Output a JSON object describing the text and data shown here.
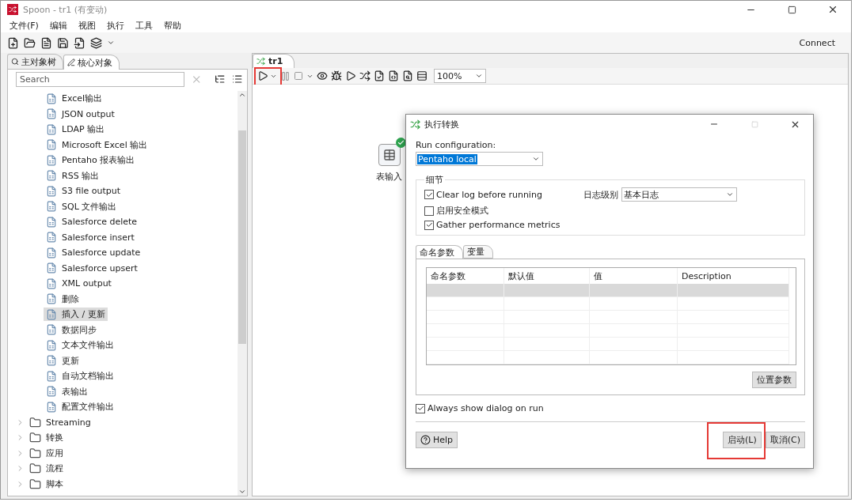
{
  "window": {
    "title": "Spoon - tr1 (有变动)"
  },
  "menu": [
    "文件(F)",
    "编辑",
    "视图",
    "执行",
    "工具",
    "帮助"
  ],
  "toolbar": {
    "connect": "Connect"
  },
  "left_panel": {
    "tabs": [
      {
        "label": "主对象树",
        "selected": false
      },
      {
        "label": "核心对象",
        "selected": true
      }
    ],
    "search": {
      "placeholder": "Search"
    },
    "steps": [
      {
        "label": "Excel输出",
        "selected": false
      },
      {
        "label": "JSON output",
        "selected": false
      },
      {
        "label": "LDAP 输出",
        "selected": false
      },
      {
        "label": "Microsoft Excel 输出",
        "selected": false
      },
      {
        "label": "Pentaho 报表输出",
        "selected": false
      },
      {
        "label": "RSS 输出",
        "selected": false
      },
      {
        "label": "S3 file output",
        "selected": false
      },
      {
        "label": "SQL 文件输出",
        "selected": false
      },
      {
        "label": "Salesforce delete",
        "selected": false
      },
      {
        "label": "Salesforce insert",
        "selected": false
      },
      {
        "label": "Salesforce update",
        "selected": false
      },
      {
        "label": "Salesforce upsert",
        "selected": false
      },
      {
        "label": "XML output",
        "selected": false
      },
      {
        "label": "删除",
        "selected": false
      },
      {
        "label": "插入 / 更新",
        "selected": true
      },
      {
        "label": "数据同步",
        "selected": false
      },
      {
        "label": "文本文件输出",
        "selected": false
      },
      {
        "label": "更新",
        "selected": false
      },
      {
        "label": "自动文档输出",
        "selected": false
      },
      {
        "label": "表输出",
        "selected": false
      },
      {
        "label": "配置文件输出",
        "selected": false
      }
    ],
    "folders": [
      {
        "label": "Streaming",
        "expanded": false
      },
      {
        "label": "转换",
        "expanded": false
      },
      {
        "label": "应用",
        "expanded": false
      },
      {
        "label": "流程",
        "expanded": false
      },
      {
        "label": "脚本",
        "expanded": false
      }
    ]
  },
  "editor": {
    "tab": {
      "label": "tr1",
      "selected": true
    },
    "run_highlighted": true,
    "zoom": "100%",
    "node": {
      "label": "表输入",
      "ok": true
    }
  },
  "dialog": {
    "title": "执行转换",
    "run_configuration": {
      "label": "Run configuration:",
      "value": "Pentaho local"
    },
    "details": {
      "title": "细节",
      "options": [
        {
          "label": "Clear log before running",
          "checked": true
        },
        {
          "label": "启用安全模式",
          "checked": false
        },
        {
          "label": "Gather performance metrics",
          "checked": true
        }
      ],
      "log_level": {
        "label": "日志级别",
        "value": "基本日志"
      }
    },
    "tabs": [
      {
        "label": "命名参数",
        "selected": true
      },
      {
        "label": "变量",
        "selected": false
      }
    ],
    "table": {
      "columns": [
        "命名参数",
        "默认值",
        "值",
        "Description"
      ],
      "rows": [
        {
          "selected": true
        },
        {
          "selected": false
        },
        {
          "selected": false
        },
        {
          "selected": false
        },
        {
          "selected": false
        },
        {
          "selected": false
        }
      ]
    },
    "position_params_button": "位置参数",
    "always_show": {
      "label": "Always show dialog on run",
      "checked": true
    },
    "buttons": [
      {
        "label": "Help",
        "kind": "help",
        "highlighted": false
      },
      {
        "label": "启动(L)",
        "kind": "plain",
        "highlighted": true
      },
      {
        "label": "取消(C)",
        "kind": "plain",
        "highlighted": false
      }
    ]
  }
}
